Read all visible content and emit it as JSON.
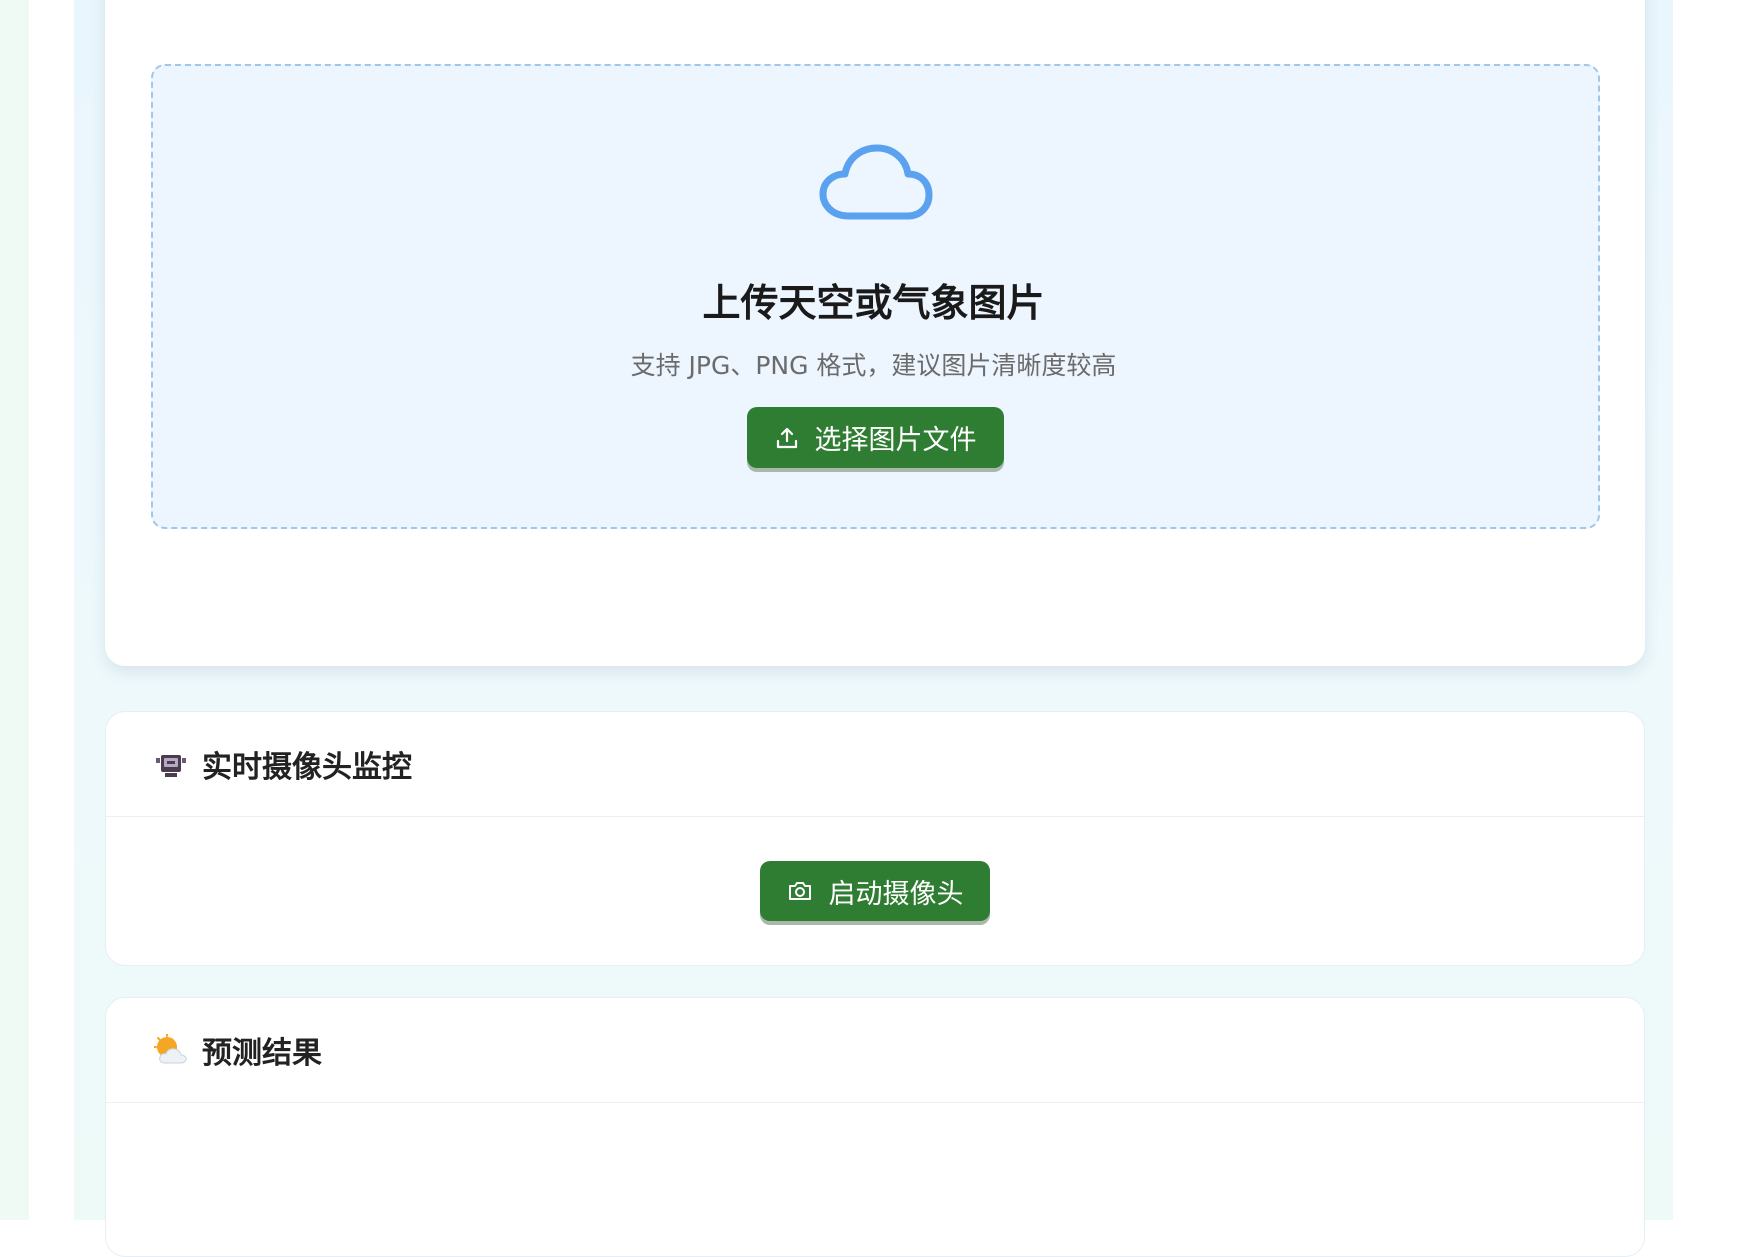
{
  "upload": {
    "title": "上传天空或气象图片",
    "hint": "支持 JPG、PNG 格式，建议图片清晰度较高",
    "select_button_label": "选择图片文件"
  },
  "camera": {
    "title": "实时摄像头监控",
    "start_button_label": "启动摄像头"
  },
  "result": {
    "title": "预测结果"
  },
  "colors": {
    "accent_green": "#2f7d32",
    "cloud_blue": "#5aa2ef",
    "dropzone_bg": "#edf5ff"
  }
}
